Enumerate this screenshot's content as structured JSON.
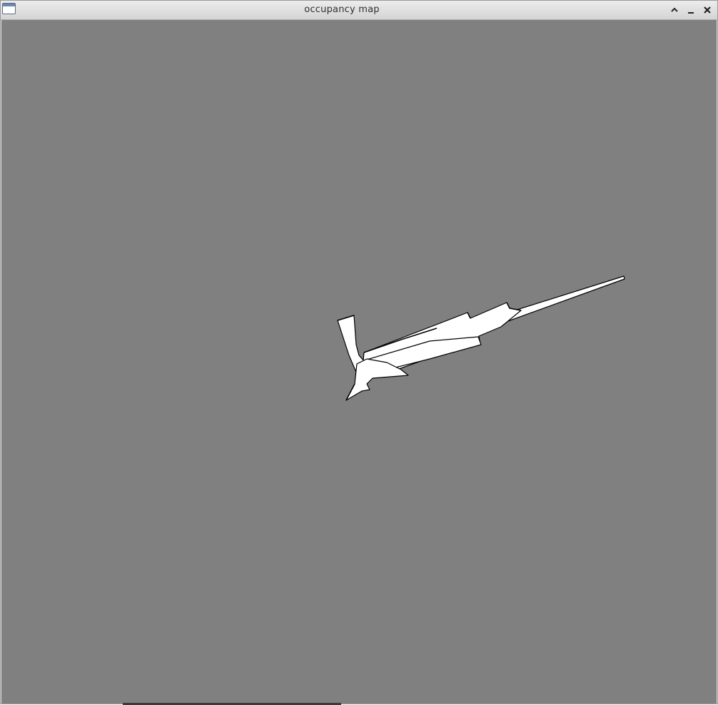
{
  "window": {
    "title": "occupancy map",
    "icon": "window-app-icon",
    "controls": {
      "shade_icon": "chevron-up-icon",
      "minimize_icon": "minimize-icon",
      "close_icon": "close-icon"
    }
  },
  "map": {
    "unknown_color": "#808080",
    "free_color": "#ffffff",
    "occupied_color": "#000000"
  }
}
